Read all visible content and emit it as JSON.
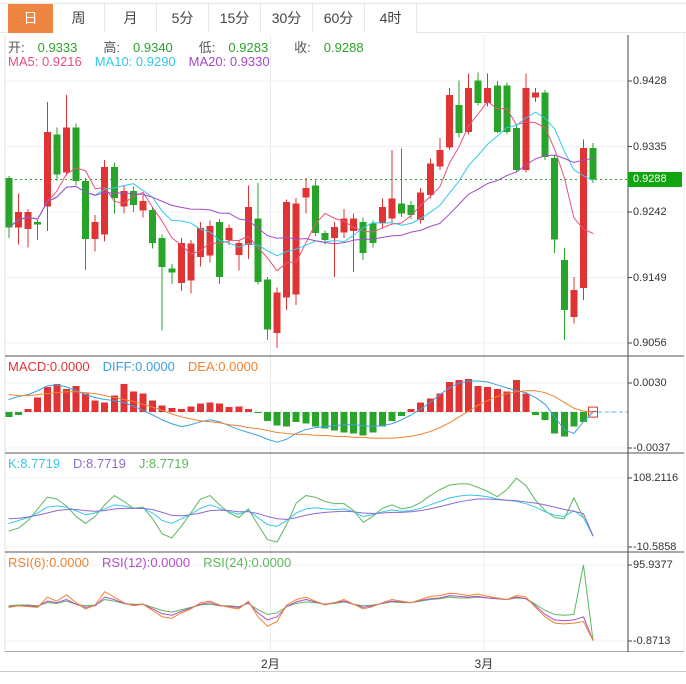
{
  "tabs": [
    {
      "name": "day",
      "label": "日",
      "active": true
    },
    {
      "name": "week",
      "label": "周",
      "active": false
    },
    {
      "name": "month",
      "label": "月",
      "active": false
    },
    {
      "name": "5min",
      "label": "5分",
      "active": false
    },
    {
      "name": "15min",
      "label": "15分",
      "active": false
    },
    {
      "name": "30min",
      "label": "30分",
      "active": false
    },
    {
      "name": "60min",
      "label": "60分",
      "active": false
    },
    {
      "name": "4hour",
      "label": "4时",
      "active": false
    }
  ],
  "colors": {
    "up": "#e03434",
    "down": "#28a428",
    "tab_active_bg": "#ee8541",
    "ohlc_value": "#2ca32c",
    "label_text": "#555",
    "tick_text": "#333",
    "ma5": "#e8507e",
    "ma10": "#35c8e8",
    "ma20": "#a24bc8",
    "macd_text": "#e03434",
    "diff": "#3d9fe0",
    "dea": "#ef8432",
    "k": "#35c8e8",
    "d": "#8d6ace",
    "j": "#5cb85c",
    "rsi6": "#ef8432",
    "rsi12": "#b44bc8",
    "rsi24": "#5cb85c",
    "price_tag_bg": "#11a611",
    "grid": "#edf1f6",
    "axis": "#444",
    "separator": "#555"
  },
  "legends": {
    "ohlc": [
      {
        "label": "开:",
        "value": "0.9333"
      },
      {
        "label": "高:",
        "value": "0.9340"
      },
      {
        "label": "低:",
        "value": "0.9283"
      },
      {
        "label": "收:",
        "value": "0.9288"
      }
    ],
    "ma": [
      {
        "text": "MA5: 0.9216",
        "color_key": "ma5"
      },
      {
        "text": "MA10: 0.9290",
        "color_key": "ma10"
      },
      {
        "text": "MA20: 0.9330",
        "color_key": "ma20"
      }
    ],
    "macd": [
      {
        "text": "MACD:0.0000",
        "color_key": "macd_text"
      },
      {
        "text": "DIFF:0.0000",
        "color_key": "diff"
      },
      {
        "text": "DEA:0.0000",
        "color_key": "dea"
      }
    ],
    "kdj": [
      {
        "text": "K:8.7719",
        "color_key": "k"
      },
      {
        "text": "D:8.7719",
        "color_key": "d"
      },
      {
        "text": "J:8.7719",
        "color_key": "j"
      }
    ],
    "rsi": [
      {
        "text": "RSI(6):0.0000",
        "color_key": "rsi6"
      },
      {
        "text": "RSI(12):0.0000",
        "color_key": "rsi12"
      },
      {
        "text": "RSI(24):0.0000",
        "color_key": "rsi24"
      }
    ]
  },
  "chart_data": {
    "type": "candlestick+indicators",
    "xticks": [
      {
        "label": "2月",
        "index": 27.3
      },
      {
        "label": "3月",
        "index": 49.6
      }
    ],
    "main": {
      "yticks": [
        "0.9428",
        "0.9335",
        "0.9242",
        "0.9149",
        "0.9056"
      ],
      "price_tag": "0.9288",
      "current_price": 0.9288,
      "ma_windows": [
        5,
        10,
        20
      ],
      "candles": [
        [
          0.929,
          0.9293,
          0.9205,
          0.922
        ],
        [
          0.922,
          0.9268,
          0.9196,
          0.9242
        ],
        [
          0.9218,
          0.9246,
          0.9192,
          0.9242
        ],
        [
          0.9228,
          0.9231,
          0.9202,
          0.9224
        ],
        [
          0.925,
          0.9398,
          0.9215,
          0.9356
        ],
        [
          0.9352,
          0.9362,
          0.9286,
          0.9295
        ],
        [
          0.9298,
          0.9408,
          0.9294,
          0.9362
        ],
        [
          0.9362,
          0.9368,
          0.928,
          0.9286
        ],
        [
          0.9286,
          0.929,
          0.916,
          0.9204
        ],
        [
          0.9204,
          0.9238,
          0.9186,
          0.9228
        ],
        [
          0.921,
          0.9316,
          0.92,
          0.9306
        ],
        [
          0.9306,
          0.9312,
          0.924,
          0.9262
        ],
        [
          0.925,
          0.928,
          0.924,
          0.9272
        ],
        [
          0.9272,
          0.9278,
          0.9242,
          0.9252
        ],
        [
          0.9244,
          0.9266,
          0.9234,
          0.9258
        ],
        [
          0.9245,
          0.925,
          0.919,
          0.9198
        ],
        [
          0.9205,
          0.921,
          0.9074,
          0.9164
        ],
        [
          0.9162,
          0.9168,
          0.914,
          0.9156
        ],
        [
          0.9141,
          0.9205,
          0.913,
          0.9198
        ],
        [
          0.9145,
          0.9202,
          0.9126,
          0.9197
        ],
        [
          0.9178,
          0.9228,
          0.9165,
          0.9219
        ],
        [
          0.918,
          0.923,
          0.917,
          0.9222
        ],
        [
          0.9228,
          0.9232,
          0.914,
          0.915
        ],
        [
          0.9202,
          0.9224,
          0.9195,
          0.9219
        ],
        [
          0.9181,
          0.9202,
          0.9159,
          0.9198
        ],
        [
          0.9195,
          0.928,
          0.9175,
          0.9249
        ],
        [
          0.9233,
          0.9283,
          0.9139,
          0.9143
        ],
        [
          0.9146,
          0.915,
          0.906,
          0.9075
        ],
        [
          0.907,
          0.9135,
          0.9049,
          0.9128
        ],
        [
          0.9121,
          0.926,
          0.9103,
          0.9256
        ],
        [
          0.9125,
          0.9262,
          0.911,
          0.9254
        ],
        [
          0.9263,
          0.929,
          0.924,
          0.9276
        ],
        [
          0.928,
          0.9287,
          0.9208,
          0.9212
        ],
        [
          0.9212,
          0.9216,
          0.9196,
          0.9202
        ],
        [
          0.9205,
          0.9228,
          0.915,
          0.9221
        ],
        [
          0.9213,
          0.9246,
          0.9205,
          0.9233
        ],
        [
          0.9215,
          0.924,
          0.9157,
          0.9233
        ],
        [
          0.9228,
          0.9234,
          0.9174,
          0.9184
        ],
        [
          0.9226,
          0.923,
          0.9192,
          0.9198
        ],
        [
          0.9226,
          0.9261,
          0.922,
          0.9249
        ],
        [
          0.9233,
          0.933,
          0.9228,
          0.9261
        ],
        [
          0.9254,
          0.9332,
          0.9235,
          0.924
        ],
        [
          0.9252,
          0.9258,
          0.9232,
          0.9238
        ],
        [
          0.9231,
          0.9276,
          0.9226,
          0.927
        ],
        [
          0.9266,
          0.9318,
          0.9261,
          0.9311
        ],
        [
          0.9307,
          0.9347,
          0.9302,
          0.933
        ],
        [
          0.9334,
          0.9418,
          0.933,
          0.9408
        ],
        [
          0.9394,
          0.9429,
          0.9348,
          0.9354
        ],
        [
          0.9356,
          0.9439,
          0.9352,
          0.9418
        ],
        [
          0.9429,
          0.944,
          0.9393,
          0.9397
        ],
        [
          0.9397,
          0.9439,
          0.9392,
          0.9418
        ],
        [
          0.9422,
          0.9428,
          0.9354,
          0.9356
        ],
        [
          0.9422,
          0.9426,
          0.9352,
          0.9356
        ],
        [
          0.9361,
          0.9366,
          0.9298,
          0.9302
        ],
        [
          0.9302,
          0.9439,
          0.9298,
          0.9418
        ],
        [
          0.9405,
          0.9418,
          0.9398,
          0.9412
        ],
        [
          0.9412,
          0.9415,
          0.9316,
          0.932
        ],
        [
          0.9319,
          0.9322,
          0.9184,
          0.9203
        ],
        [
          0.9174,
          0.9191,
          0.906,
          0.9103
        ],
        [
          0.9093,
          0.915,
          0.9084,
          0.9131
        ],
        [
          0.9134,
          0.9345,
          0.9117,
          0.9333
        ],
        [
          0.9333,
          0.934,
          0.9283,
          0.9288
        ]
      ]
    },
    "macd": {
      "yticks": [
        "0.0030",
        "-0.0037"
      ],
      "hist": [
        -0.0005,
        -0.0003,
        0.0003,
        0.0015,
        0.0026,
        0.0029,
        0.0024,
        0.0027,
        0.0019,
        0.0012,
        0.001,
        0.0017,
        0.0029,
        0.0021,
        0.0019,
        0.0012,
        0.0007,
        0.0004,
        0.0003,
        0.0006,
        0.0009,
        0.001,
        0.0009,
        0.0005,
        0.0006,
        0.0003,
        -0.0001,
        -0.0009,
        -0.0014,
        -0.0015,
        -0.001,
        -0.0012,
        -0.0015,
        -0.0017,
        -0.0019,
        -0.0021,
        -0.0022,
        -0.0024,
        -0.0021,
        -0.0015,
        -0.0009,
        -0.0004,
        0.0003,
        0.001,
        0.0014,
        0.0019,
        0.0031,
        0.0033,
        0.0034,
        0.0027,
        0.0026,
        0.0024,
        0.0021,
        0.0033,
        0.0019,
        -0.0003,
        -0.0008,
        -0.0022,
        -0.0025,
        -0.0015,
        -0.001,
        0.0001
      ],
      "diff": [
        0.0013,
        0.0016,
        0.0018,
        0.0022,
        0.0027,
        0.0028,
        0.0026,
        0.0022,
        0.0018,
        0.0015,
        0.0013,
        0.0012,
        0.001,
        0.0006,
        0.0002,
        -0.0003,
        -0.0008,
        -0.0012,
        -0.0015,
        -0.0013,
        -0.001,
        -0.0008,
        -0.001,
        -0.0014,
        -0.0018,
        -0.0021,
        -0.0024,
        -0.0028,
        -0.0031,
        -0.0028,
        -0.0022,
        -0.0018,
        -0.0016,
        -0.0015,
        -0.0014,
        -0.0013,
        -0.0013,
        -0.0014,
        -0.0015,
        -0.0014,
        -0.0012,
        -0.0008,
        -0.0003,
        0.0003,
        0.001,
        0.0018,
        0.0025,
        0.003,
        0.0032,
        0.0032,
        0.0031,
        0.0028,
        0.0025,
        0.0022,
        0.002,
        0.0015,
        0.0008,
        -0.0005,
        -0.0018,
        -0.0022,
        -0.001,
        0.0
      ],
      "dea": [
        0.0018,
        0.0017,
        0.0017,
        0.0018,
        0.0019,
        0.002,
        0.0021,
        0.0021,
        0.002,
        0.0019,
        0.0017,
        0.0015,
        0.0013,
        0.0011,
        0.0008,
        0.0005,
        0.0002,
        -0.0002,
        -0.0005,
        -0.0007,
        -0.0009,
        -0.001,
        -0.0011,
        -0.0013,
        -0.0014,
        -0.0016,
        -0.0017,
        -0.0019,
        -0.0021,
        -0.0022,
        -0.0023,
        -0.0023,
        -0.0024,
        -0.0024,
        -0.0025,
        -0.0025,
        -0.0026,
        -0.0026,
        -0.0027,
        -0.0027,
        -0.0027,
        -0.0026,
        -0.0025,
        -0.0023,
        -0.002,
        -0.0016,
        -0.0011,
        -0.0005,
        0.0001,
        0.0007,
        0.0012,
        0.0016,
        0.0019,
        0.0021,
        0.0022,
        0.0022,
        0.002,
        0.0016,
        0.001,
        0.0004,
        0.0001,
        0.0
      ]
    },
    "kdj": {
      "yticks": [
        "108.2116",
        "-10.5858"
      ],
      "k": [
        30,
        35,
        40,
        48,
        58,
        60,
        58,
        52,
        45,
        48,
        55,
        62,
        60,
        56,
        56,
        48,
        35,
        30,
        38,
        46,
        56,
        62,
        56,
        50,
        46,
        52,
        40,
        28,
        25,
        35,
        48,
        55,
        57,
        55,
        54,
        55,
        50,
        42,
        45,
        50,
        53,
        51,
        52,
        56,
        62,
        68,
        74,
        77,
        79,
        78,
        76,
        72,
        70,
        68,
        64,
        58,
        50,
        44,
        42,
        52,
        40,
        8.77
      ],
      "d": [
        38,
        39,
        41,
        44,
        48,
        52,
        54,
        54,
        52,
        51,
        52,
        55,
        56,
        56,
        56,
        54,
        49,
        44,
        43,
        45,
        48,
        52,
        53,
        52,
        50,
        50,
        47,
        42,
        38,
        37,
        40,
        44,
        47,
        49,
        50,
        51,
        50,
        48,
        47,
        48,
        49,
        49,
        50,
        52,
        55,
        59,
        63,
        67,
        70,
        72,
        72,
        71,
        70,
        69,
        67,
        65,
        62,
        58,
        54,
        51,
        47,
        8.77
      ],
      "j": [
        17,
        22,
        35,
        55,
        75,
        72,
        60,
        42,
        30,
        42,
        62,
        78,
        68,
        56,
        58,
        38,
        12,
        5,
        25,
        48,
        72,
        78,
        62,
        48,
        40,
        55,
        28,
        2,
        -2,
        28,
        65,
        78,
        75,
        68,
        64,
        64,
        52,
        32,
        42,
        56,
        62,
        55,
        58,
        66,
        78,
        88,
        96,
        98,
        98,
        92,
        85,
        76,
        88,
        108,
        95,
        70,
        52,
        40,
        38,
        74,
        40,
        8.77
      ]
    },
    "rsi": {
      "yticks": [
        "95.9377",
        "-0.8713"
      ],
      "rsi6": [
        42,
        44,
        43,
        42,
        55,
        50,
        58,
        48,
        40,
        45,
        62,
        55,
        48,
        44,
        46,
        38,
        30,
        28,
        35,
        40,
        48,
        50,
        45,
        42,
        40,
        50,
        30,
        18,
        24,
        45,
        52,
        55,
        50,
        45,
        48,
        52,
        46,
        40,
        43,
        48,
        52,
        50,
        48,
        52,
        56,
        57,
        60,
        59,
        57,
        59,
        56,
        54,
        52,
        57,
        55,
        42,
        30,
        22,
        21,
        22,
        24,
        0
      ],
      "rsi12": [
        43,
        44,
        44,
        43,
        50,
        48,
        52,
        46,
        42,
        44,
        55,
        52,
        47,
        45,
        46,
        40,
        34,
        32,
        37,
        41,
        46,
        48,
        44,
        43,
        42,
        48,
        35,
        26,
        30,
        43,
        49,
        52,
        49,
        46,
        48,
        50,
        46,
        42,
        44,
        47,
        50,
        49,
        48,
        51,
        53,
        54,
        57,
        56,
        55,
        56,
        54,
        53,
        52,
        55,
        53,
        44,
        33,
        26,
        25,
        26,
        30,
        0
      ],
      "rsi24": [
        44,
        45,
        45,
        44,
        48,
        47,
        50,
        46,
        44,
        45,
        52,
        50,
        47,
        46,
        46,
        42,
        38,
        36,
        39,
        42,
        45,
        46,
        44,
        44,
        43,
        47,
        39,
        33,
        35,
        43,
        47,
        49,
        48,
        46,
        47,
        49,
        46,
        44,
        45,
        47,
        49,
        48,
        48,
        50,
        52,
        53,
        55,
        54,
        54,
        55,
        54,
        53,
        52,
        54,
        53,
        46,
        38,
        33,
        32,
        33,
        95.94,
        0
      ]
    }
  }
}
